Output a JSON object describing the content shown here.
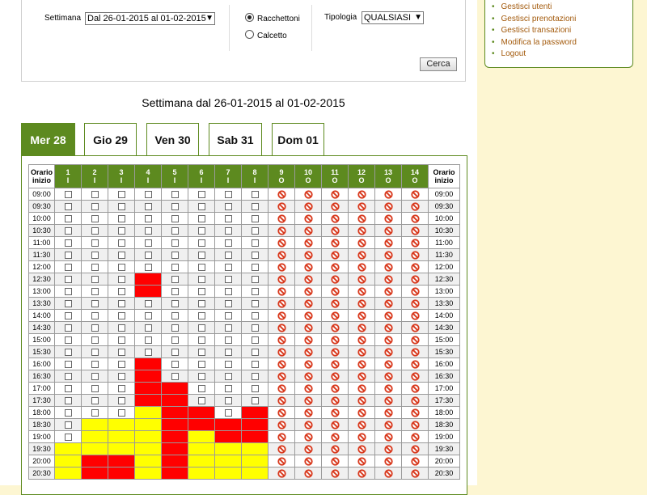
{
  "search": {
    "week_label": "Settimana",
    "week_value": "Dal 26-01-2015 al 01-02-2015",
    "sport_options": [
      "Racchettoni",
      "Calcetto"
    ],
    "sport_selected": 0,
    "type_label": "Tipologia",
    "type_value": "QUALSIASI",
    "search_button": "Cerca"
  },
  "week_title": "Settimana dal 26-01-2015 al 01-02-2015",
  "tabs": [
    {
      "label": "Mer 28",
      "active": true
    },
    {
      "label": "Gio 29",
      "active": false
    },
    {
      "label": "Ven 30",
      "active": false
    },
    {
      "label": "Sab 31",
      "active": false
    },
    {
      "label": "Dom 01",
      "active": false
    }
  ],
  "menu": {
    "items": [
      "Gestisci utenti",
      "Gestisci prenotazioni",
      "Gestisci transazioni",
      "Modifica la password",
      "Logout"
    ]
  },
  "grid": {
    "time_header": "Orario inizio",
    "courts": [
      {
        "num": "1",
        "type": "I"
      },
      {
        "num": "2",
        "type": "I"
      },
      {
        "num": "3",
        "type": "I"
      },
      {
        "num": "4",
        "type": "I"
      },
      {
        "num": "5",
        "type": "I"
      },
      {
        "num": "6",
        "type": "I"
      },
      {
        "num": "7",
        "type": "I"
      },
      {
        "num": "8",
        "type": "I"
      },
      {
        "num": "9",
        "type": "O"
      },
      {
        "num": "10",
        "type": "O"
      },
      {
        "num": "11",
        "type": "O"
      },
      {
        "num": "12",
        "type": "O"
      },
      {
        "num": "13",
        "type": "O"
      },
      {
        "num": "14",
        "type": "O"
      }
    ],
    "legend_note": "c = free checkbox, r = booked (red), y = booked (yellow), n = unavailable",
    "rows": [
      {
        "time": "09:00",
        "cells": "ccccccccnnnnnn"
      },
      {
        "time": "09:30",
        "cells": "ccccccccnnnnnn"
      },
      {
        "time": "10:00",
        "cells": "ccccccccnnnnnn"
      },
      {
        "time": "10:30",
        "cells": "ccccccccnnnnnn"
      },
      {
        "time": "11:00",
        "cells": "ccccccccnnnnnn"
      },
      {
        "time": "11:30",
        "cells": "ccccccccnnnnnn"
      },
      {
        "time": "12:00",
        "cells": "ccccccccnnnnnn"
      },
      {
        "time": "12:30",
        "cells": "cccrccccnnnnnn"
      },
      {
        "time": "13:00",
        "cells": "cccrccccnnnnnn"
      },
      {
        "time": "13:30",
        "cells": "ccccccccnnnnnn"
      },
      {
        "time": "14:00",
        "cells": "ccccccccnnnnnn"
      },
      {
        "time": "14:30",
        "cells": "ccccccccnnnnnn"
      },
      {
        "time": "15:00",
        "cells": "ccccccccnnnnnn"
      },
      {
        "time": "15:30",
        "cells": "ccccccccnnnnnn"
      },
      {
        "time": "16:00",
        "cells": "cccrccccnnnnnn"
      },
      {
        "time": "16:30",
        "cells": "cccrccccnnnnnn"
      },
      {
        "time": "17:00",
        "cells": "cccrrcccnnnnnn"
      },
      {
        "time": "17:30",
        "cells": "cccrrcccnnnnnn"
      },
      {
        "time": "18:00",
        "cells": "cccyrrcrnnnnnn"
      },
      {
        "time": "18:30",
        "cells": "cyyyrrrrnnnnnn"
      },
      {
        "time": "19:00",
        "cells": "cyyyryrrnnnnnn"
      },
      {
        "time": "19:30",
        "cells": "yyyyryyynnnnnn"
      },
      {
        "time": "20:00",
        "cells": "yrryryyynnnnnn"
      },
      {
        "time": "20:30",
        "cells": "yrryryyynnnnnn"
      }
    ]
  },
  "colors": {
    "accent": "#5d8a1f",
    "booked_red": "#ff0000",
    "booked_yellow": "#ffff00",
    "page_bg": "#fdf6d2",
    "link": "#a35a0c"
  }
}
